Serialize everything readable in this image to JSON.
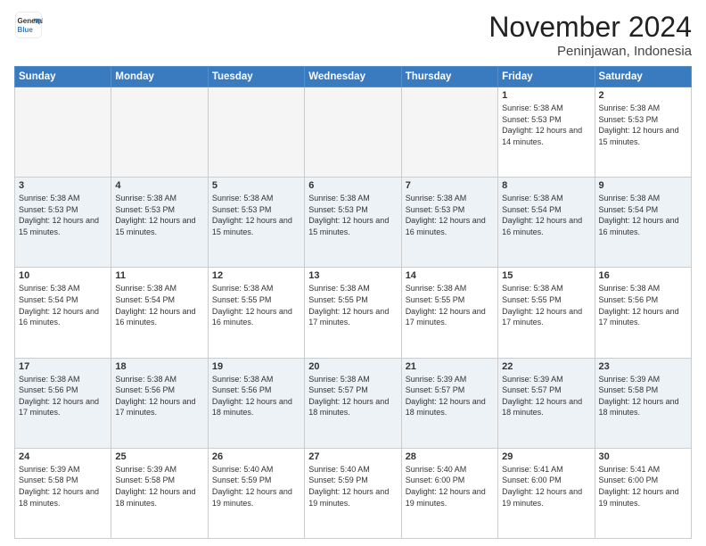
{
  "header": {
    "logo_line1": "General",
    "logo_line2": "Blue",
    "month": "November 2024",
    "location": "Peninjawan, Indonesia"
  },
  "weekdays": [
    "Sunday",
    "Monday",
    "Tuesday",
    "Wednesday",
    "Thursday",
    "Friday",
    "Saturday"
  ],
  "weeks": [
    [
      {
        "day": "",
        "info": ""
      },
      {
        "day": "",
        "info": ""
      },
      {
        "day": "",
        "info": ""
      },
      {
        "day": "",
        "info": ""
      },
      {
        "day": "",
        "info": ""
      },
      {
        "day": "1",
        "info": "Sunrise: 5:38 AM\nSunset: 5:53 PM\nDaylight: 12 hours\nand 14 minutes."
      },
      {
        "day": "2",
        "info": "Sunrise: 5:38 AM\nSunset: 5:53 PM\nDaylight: 12 hours\nand 15 minutes."
      }
    ],
    [
      {
        "day": "3",
        "info": "Sunrise: 5:38 AM\nSunset: 5:53 PM\nDaylight: 12 hours\nand 15 minutes."
      },
      {
        "day": "4",
        "info": "Sunrise: 5:38 AM\nSunset: 5:53 PM\nDaylight: 12 hours\nand 15 minutes."
      },
      {
        "day": "5",
        "info": "Sunrise: 5:38 AM\nSunset: 5:53 PM\nDaylight: 12 hours\nand 15 minutes."
      },
      {
        "day": "6",
        "info": "Sunrise: 5:38 AM\nSunset: 5:53 PM\nDaylight: 12 hours\nand 15 minutes."
      },
      {
        "day": "7",
        "info": "Sunrise: 5:38 AM\nSunset: 5:53 PM\nDaylight: 12 hours\nand 16 minutes."
      },
      {
        "day": "8",
        "info": "Sunrise: 5:38 AM\nSunset: 5:54 PM\nDaylight: 12 hours\nand 16 minutes."
      },
      {
        "day": "9",
        "info": "Sunrise: 5:38 AM\nSunset: 5:54 PM\nDaylight: 12 hours\nand 16 minutes."
      }
    ],
    [
      {
        "day": "10",
        "info": "Sunrise: 5:38 AM\nSunset: 5:54 PM\nDaylight: 12 hours\nand 16 minutes."
      },
      {
        "day": "11",
        "info": "Sunrise: 5:38 AM\nSunset: 5:54 PM\nDaylight: 12 hours\nand 16 minutes."
      },
      {
        "day": "12",
        "info": "Sunrise: 5:38 AM\nSunset: 5:55 PM\nDaylight: 12 hours\nand 16 minutes."
      },
      {
        "day": "13",
        "info": "Sunrise: 5:38 AM\nSunset: 5:55 PM\nDaylight: 12 hours\nand 17 minutes."
      },
      {
        "day": "14",
        "info": "Sunrise: 5:38 AM\nSunset: 5:55 PM\nDaylight: 12 hours\nand 17 minutes."
      },
      {
        "day": "15",
        "info": "Sunrise: 5:38 AM\nSunset: 5:55 PM\nDaylight: 12 hours\nand 17 minutes."
      },
      {
        "day": "16",
        "info": "Sunrise: 5:38 AM\nSunset: 5:56 PM\nDaylight: 12 hours\nand 17 minutes."
      }
    ],
    [
      {
        "day": "17",
        "info": "Sunrise: 5:38 AM\nSunset: 5:56 PM\nDaylight: 12 hours\nand 17 minutes."
      },
      {
        "day": "18",
        "info": "Sunrise: 5:38 AM\nSunset: 5:56 PM\nDaylight: 12 hours\nand 17 minutes."
      },
      {
        "day": "19",
        "info": "Sunrise: 5:38 AM\nSunset: 5:56 PM\nDaylight: 12 hours\nand 18 minutes."
      },
      {
        "day": "20",
        "info": "Sunrise: 5:38 AM\nSunset: 5:57 PM\nDaylight: 12 hours\nand 18 minutes."
      },
      {
        "day": "21",
        "info": "Sunrise: 5:39 AM\nSunset: 5:57 PM\nDaylight: 12 hours\nand 18 minutes."
      },
      {
        "day": "22",
        "info": "Sunrise: 5:39 AM\nSunset: 5:57 PM\nDaylight: 12 hours\nand 18 minutes."
      },
      {
        "day": "23",
        "info": "Sunrise: 5:39 AM\nSunset: 5:58 PM\nDaylight: 12 hours\nand 18 minutes."
      }
    ],
    [
      {
        "day": "24",
        "info": "Sunrise: 5:39 AM\nSunset: 5:58 PM\nDaylight: 12 hours\nand 18 minutes."
      },
      {
        "day": "25",
        "info": "Sunrise: 5:39 AM\nSunset: 5:58 PM\nDaylight: 12 hours\nand 18 minutes."
      },
      {
        "day": "26",
        "info": "Sunrise: 5:40 AM\nSunset: 5:59 PM\nDaylight: 12 hours\nand 19 minutes."
      },
      {
        "day": "27",
        "info": "Sunrise: 5:40 AM\nSunset: 5:59 PM\nDaylight: 12 hours\nand 19 minutes."
      },
      {
        "day": "28",
        "info": "Sunrise: 5:40 AM\nSunset: 6:00 PM\nDaylight: 12 hours\nand 19 minutes."
      },
      {
        "day": "29",
        "info": "Sunrise: 5:41 AM\nSunset: 6:00 PM\nDaylight: 12 hours\nand 19 minutes."
      },
      {
        "day": "30",
        "info": "Sunrise: 5:41 AM\nSunset: 6:00 PM\nDaylight: 12 hours\nand 19 minutes."
      }
    ]
  ]
}
